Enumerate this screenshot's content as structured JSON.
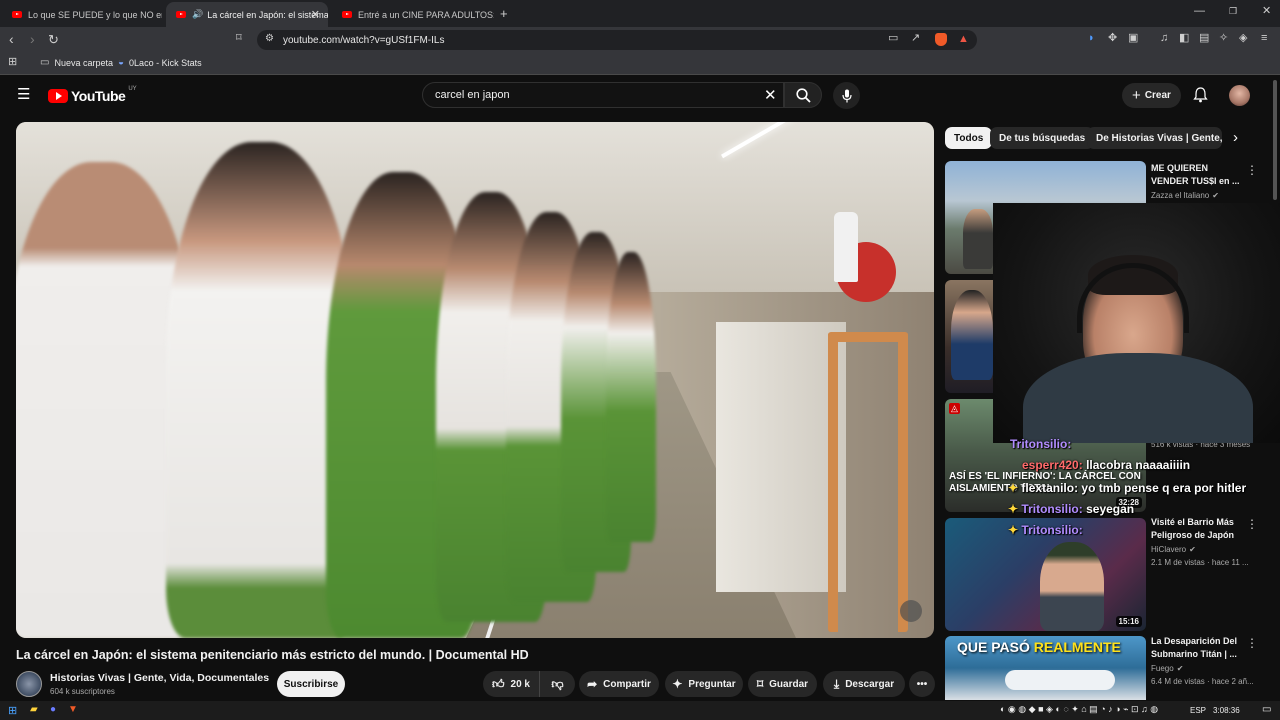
{
  "browser": {
    "tabs": [
      {
        "label": "Lo que SE PUEDE y lo que NO en"
      },
      {
        "label": "La cárcel en Japón: el sistema"
      },
      {
        "label": "Entré a un CINE PARA ADULTOS: ¿Có"
      }
    ],
    "url": "youtube.com/watch?v=gUSf1FM-ILs",
    "bookmarks": [
      {
        "label": "Nueva carpeta"
      },
      {
        "label": "0Laco - Kick Stats"
      }
    ]
  },
  "youtube": {
    "logo_text": "YouTube",
    "region": "UY",
    "search_value": "carcel en japon",
    "create_label": "Crear"
  },
  "video": {
    "title": "La cárcel en Japón: el sistema penitenciario más estricto del mundo. | Documental HD",
    "channel": "Historias Vivas | Gente, Vida, Documentales",
    "subscribers": "604 k suscriptores",
    "subscribe_label": "Suscribirse",
    "likes": "20 k",
    "share_label": "Compartir",
    "ask_label": "Preguntar",
    "save_label": "Guardar",
    "download_label": "Descargar"
  },
  "chips": [
    {
      "label": "Todos"
    },
    {
      "label": "De tus búsquedas"
    },
    {
      "label": "De Historias Vivas | Gente, Vi"
    }
  ],
  "recommendations": [
    {
      "title": "ME QUIEREN VENDER TUS$I en ...",
      "channel": "Zazza el Italiano",
      "meta": ""
    },
    {
      "title": "",
      "channel": "",
      "meta": "516 k vistas · hace 3 meses",
      "duration": "32:28",
      "thumb_text": "ASÍ ES 'EL INFIERNO': LA CÁRCEL CON AISLAMIENTO TOTAL"
    },
    {
      "title": "Visité el Barrio Más Peligroso de Japón",
      "channel": "HiClavero",
      "meta": "2.1 M de vistas · hace 11 ...",
      "duration": "15:16"
    },
    {
      "title": "La Desaparición Del Submarino Titán | ...",
      "channel": "Fuego",
      "meta": "6.4 M de vistas · hace 2 añ...",
      "thumb_text_a": "QUE PASÓ",
      "thumb_text_b": "REALMENTE"
    }
  ],
  "chat": [
    {
      "user": "Tritonsilio:",
      "message": ""
    },
    {
      "user": "esperr420:",
      "message": "llacobra naaaaiiiin"
    },
    {
      "user": "flextanilo:",
      "message": "yo tmb pense q era por hitler"
    },
    {
      "user": "Tritonsilio:",
      "message": "seyegan"
    },
    {
      "user": "Tritonsilio:",
      "message": ""
    }
  ],
  "taskbar": {
    "lang": "ESP",
    "time": "3:08:36"
  }
}
